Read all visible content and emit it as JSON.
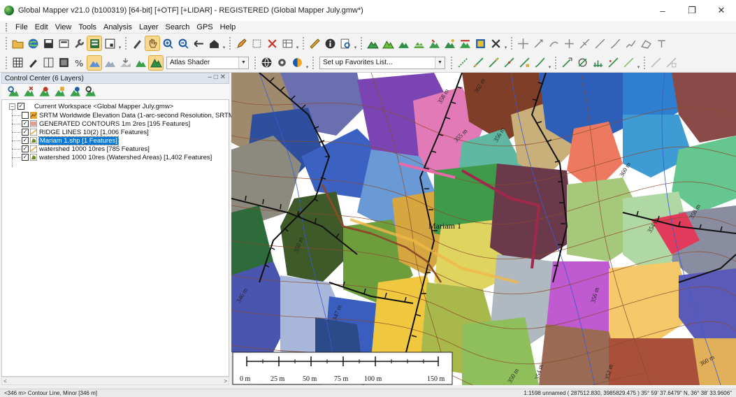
{
  "window": {
    "title": "Global Mapper v21.0 (b100319) [64-bit] [+OTF] [+LIDAR] - REGISTERED (Global Mapper July.gmw*)",
    "minimize_glyph": "–",
    "restore_glyph": "❐",
    "close_glyph": "✕"
  },
  "menu": [
    "File",
    "Edit",
    "View",
    "Tools",
    "Analysis",
    "Layer",
    "Search",
    "GPS",
    "Help"
  ],
  "toolbar2": {
    "shader_value": "Atlas Shader",
    "favorites_value": "Set up Favorites List..."
  },
  "control_center": {
    "title": "Control Center (6 Layers)",
    "header_buttons": "– □ ✕",
    "workspace": "Current Workspace <Global Mapper July.gmw>",
    "layers": [
      {
        "label": "SRTM Worldwide Elevation Data (1-arc-second Resolution, SRTM",
        "checked": false,
        "icon": "elevation-grid-icon"
      },
      {
        "label": "GENERATED CONTOURS 1m 2res [195 Features]",
        "checked": true,
        "icon": "contour-layer-icon"
      },
      {
        "label": "RIDGE LINES 10(2) [1,006 Features]",
        "checked": true,
        "icon": "line-layer-icon"
      },
      {
        "label": "Mariam 1.shp [1 Features]",
        "checked": true,
        "icon": "area-layer-icon",
        "selected": true
      },
      {
        "label": "watershed 1000 10res [785 Features]",
        "checked": true,
        "icon": "line-layer-icon"
      },
      {
        "label": "watershed 1000 10res (Watershed Areas) [1,402 Features]",
        "checked": true,
        "icon": "area-layer-icon"
      }
    ]
  },
  "map": {
    "feature_label": "Mariam 1",
    "contour_labels": [
      "362 m",
      "358 m",
      "356 m",
      "355 m",
      "360 m",
      "358 m",
      "354 m",
      "346 m",
      "352 m",
      "356 m",
      "350 m",
      "354 m",
      "360 m",
      "347 m",
      "350 m"
    ],
    "scale_labels": [
      "0 m",
      "25 m",
      "50 m",
      "75 m",
      "100 m",
      "150 m"
    ],
    "colors": {
      "contour": "#8a4a2a",
      "ridge": "#111111",
      "stream": "#3a5bd0",
      "feature": "#a0284a"
    }
  },
  "status": {
    "left": "<346 m> Contour Line, Minor [346 m]",
    "right": "1:1598  unnamed ( 287512.830, 3985829.475 )  35° 59' 37.6479\" N, 36° 38' 33.9606\""
  }
}
